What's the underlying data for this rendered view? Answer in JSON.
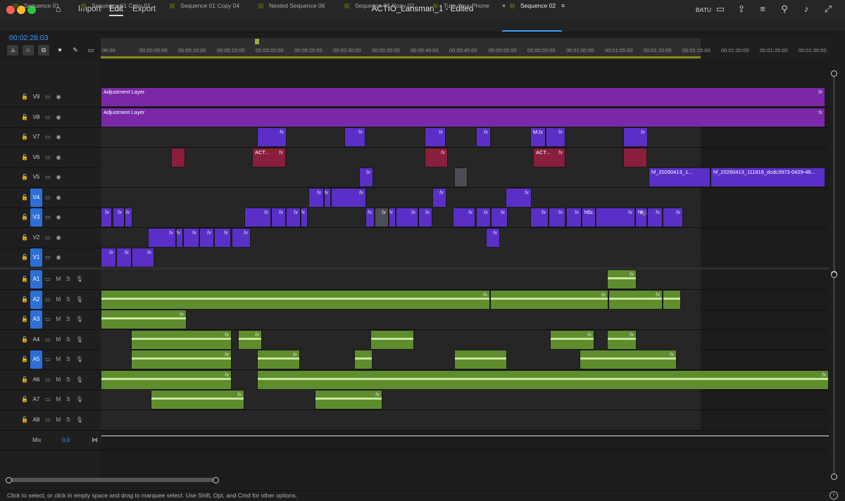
{
  "window": {
    "title": "ACTIO_Lansman_1 - Edited",
    "menu": [
      "Import",
      "Edit",
      "Export"
    ],
    "active_menu": "Edit",
    "workspace_label": "BATU"
  },
  "tabs": [
    "Sequence 01",
    "Sequence 01 Copy 01",
    "Sequence 01 Copy 04",
    "Nested Sequence 06",
    "Sequence 01 Copy 02",
    "Turn-Your-Phone",
    "Sequence 02"
  ],
  "active_tab": "Sequence 02",
  "timecode": "00:02:28:03",
  "ruler": [
    "00:00",
    "00:00:05:00",
    "00:00:10:00",
    "00:00:15:00",
    "00:00:20:00",
    "00:00:25:00",
    "00:00:30:00",
    "00:00:35:00",
    "00:00:40:00",
    "00:00:45:00",
    "00:00:50:00",
    "00:00:55:00",
    "00:01:00:00",
    "00:01:05:00",
    "00:01:10:00",
    "00:01:15:00",
    "00:01:20:00",
    "00:01:25:00",
    "00:01:30:00"
  ],
  "video_tracks": [
    {
      "name": "V9",
      "target": false
    },
    {
      "name": "V8",
      "target": false
    },
    {
      "name": "V7",
      "target": false
    },
    {
      "name": "V6",
      "target": false
    },
    {
      "name": "V5",
      "target": false
    },
    {
      "name": "V4",
      "target": true
    },
    {
      "name": "V3",
      "target": true
    },
    {
      "name": "V2",
      "target": false
    },
    {
      "name": "V1",
      "target": true
    }
  ],
  "audio_tracks": [
    {
      "name": "A1",
      "target": true
    },
    {
      "name": "A2",
      "target": true
    },
    {
      "name": "A3",
      "target": true
    },
    {
      "name": "A4",
      "target": false
    },
    {
      "name": "A5",
      "target": true
    },
    {
      "name": "A6",
      "target": false
    },
    {
      "name": "A7",
      "target": false
    },
    {
      "name": "A8",
      "target": false
    }
  ],
  "audio_toggles": {
    "mute": "M",
    "solo": "S"
  },
  "mix": {
    "label": "Mix",
    "value": "0,0"
  },
  "clip_labels": {
    "adjustment": "Adjustment Layer",
    "fx": "fx",
    "act": "ACT...",
    "m": "M...",
    "hf1": "hf_20260413_1...",
    "hf2": "hf_20260413_111816_dcdc3973-0429-48...",
    "hf3": "hf...",
    "hf4": "hf_20..."
  },
  "status_text": "Click to select, or click in empty space and drag to marquee select. Use Shift, Opt, and Cmd for other options.",
  "colors": {
    "video": "#5a2fc8",
    "adjustment": "#7a28a8",
    "audio": "#5f8d2d",
    "accent": "#3d9cff"
  }
}
